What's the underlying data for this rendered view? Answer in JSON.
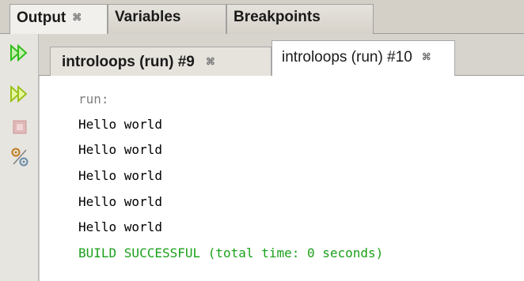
{
  "top_tabs": [
    {
      "label": "Output",
      "close": "⌘"
    },
    {
      "label": "Variables"
    },
    {
      "label": "Breakpoints"
    }
  ],
  "sub_tabs": [
    {
      "label": "introloops (run) #9",
      "close": "⌘"
    },
    {
      "label": "introloops (run) #10",
      "close": "⌘"
    }
  ],
  "toolbar": {
    "icons": [
      "rerun-icon",
      "rerun-with-options-icon",
      "stop-icon",
      "settings-icon"
    ]
  },
  "console": {
    "lines": [
      {
        "text": "run:",
        "kind": "info"
      },
      {
        "text": "Hello world",
        "kind": "output"
      },
      {
        "text": "Hello world",
        "kind": "output"
      },
      {
        "text": "Hello world",
        "kind": "output"
      },
      {
        "text": "Hello world",
        "kind": "output"
      },
      {
        "text": "Hello world",
        "kind": "output"
      },
      {
        "text": "BUILD SUCCESSFUL (total time: 0 seconds)",
        "kind": "success"
      }
    ]
  },
  "colors": {
    "info": "#808080",
    "output": "#000000",
    "success": "#1aa01a",
    "rerun_green": "#2fbf1a"
  }
}
